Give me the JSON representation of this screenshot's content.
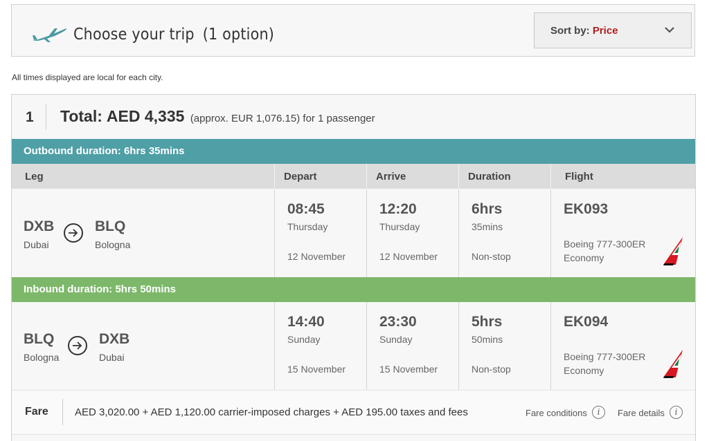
{
  "header": {
    "title": "Choose your trip",
    "count": "(1  option)",
    "icon": "airplane-icon",
    "sort": {
      "label": "Sort by:",
      "value": "Price"
    }
  },
  "note": "All times displayed are local for each city.",
  "option": {
    "number": "1",
    "total_label": "Total:",
    "total_amount": "AED 4,335",
    "approx": "(approx.  EUR 1,076.15) for 1 passenger"
  },
  "columns": {
    "leg": "Leg",
    "depart": "Depart",
    "arrive": "Arrive",
    "duration": "Duration",
    "flight": "Flight"
  },
  "outbound": {
    "duration_label": "Outbound duration: 6hrs 35mins",
    "from_code": "DXB",
    "from_city": "Dubai",
    "to_code": "BLQ",
    "to_city": "Bologna",
    "depart_time": "08:45",
    "depart_day": "Thursday",
    "depart_date": "12 November",
    "arrive_time": "12:20",
    "arrive_day": "Thursday",
    "arrive_date": "12 November",
    "duration_hrs": "6hrs",
    "duration_mins": "35mins",
    "stops": "Non-stop",
    "flight_no": "EK093",
    "aircraft": "Boeing 777-300ER",
    "cabin": "Economy"
  },
  "inbound": {
    "duration_label": "Inbound duration: 5hrs 50mins",
    "from_code": "BLQ",
    "from_city": "Bologna",
    "to_code": "DXB",
    "to_city": "Dubai",
    "depart_time": "14:40",
    "depart_day": "Sunday",
    "depart_date": "15 November",
    "arrive_time": "23:30",
    "arrive_day": "Sunday",
    "arrive_date": "15 November",
    "duration_hrs": "5hrs",
    "duration_mins": "50mins",
    "stops": "Non-stop",
    "flight_no": "EK094",
    "aircraft": "Boeing 777-300ER",
    "cabin": "Economy"
  },
  "fare": {
    "label": "Fare",
    "breakdown": "AED 3,020.00 + AED 1,120.00 carrier-imposed charges + AED 195.00 taxes and fees",
    "conditions_link": "Fare conditions",
    "details_link": "Fare details",
    "info_glyph": "i"
  },
  "colors": {
    "outbound_bar": "#4f9fa6",
    "inbound_bar": "#7db86a",
    "sort_value": "#b01e1e",
    "tail_red": "#d71921",
    "tail_green": "#00843d"
  }
}
